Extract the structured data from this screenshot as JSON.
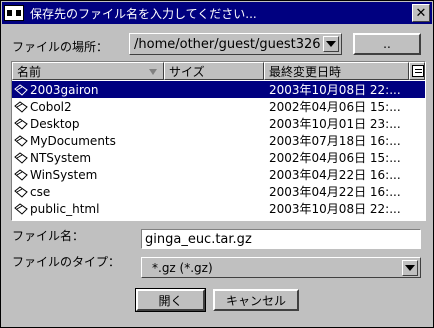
{
  "window": {
    "title": "保存先のファイル名を入力してください..."
  },
  "location": {
    "label": "ファイルの場所：",
    "value": "/home/other/guest/guest326",
    "up_label": ".."
  },
  "list": {
    "columns": [
      "名前",
      "サイズ",
      "最終変更日時"
    ],
    "rows": [
      {
        "name": "2003gairon",
        "date": "2003年10月08日 22:...",
        "selected": true
      },
      {
        "name": "Cobol2",
        "date": "2002年04月06日 15:..."
      },
      {
        "name": "Desktop",
        "date": "2003年10月01日 23:..."
      },
      {
        "name": "MyDocuments",
        "date": "2003年07月18日 16:..."
      },
      {
        "name": "NTSystem",
        "date": "2002年04月06日 15:..."
      },
      {
        "name": "WinSystem",
        "date": "2003年04月22日 16:..."
      },
      {
        "name": "cse",
        "date": "2003年04月22日 16:..."
      },
      {
        "name": "public_html",
        "date": "2003年10月08日 22:..."
      }
    ]
  },
  "filename": {
    "label": "ファイル名：",
    "value": "ginga_euc.tar.gz"
  },
  "filetype": {
    "label": "ファイルのタイプ：",
    "value": "*.gz (*.gz)"
  },
  "buttons": {
    "open": "開く",
    "cancel": "キャンセル"
  },
  "icons": {
    "app": "app-icon",
    "close": "close-icon",
    "folder": "folder-icon",
    "sort": "sort-down-icon",
    "view": "view-list-icon"
  },
  "colors": {
    "titlebar": "#000080",
    "selection": "#000080",
    "face": "#c0c0c0"
  }
}
